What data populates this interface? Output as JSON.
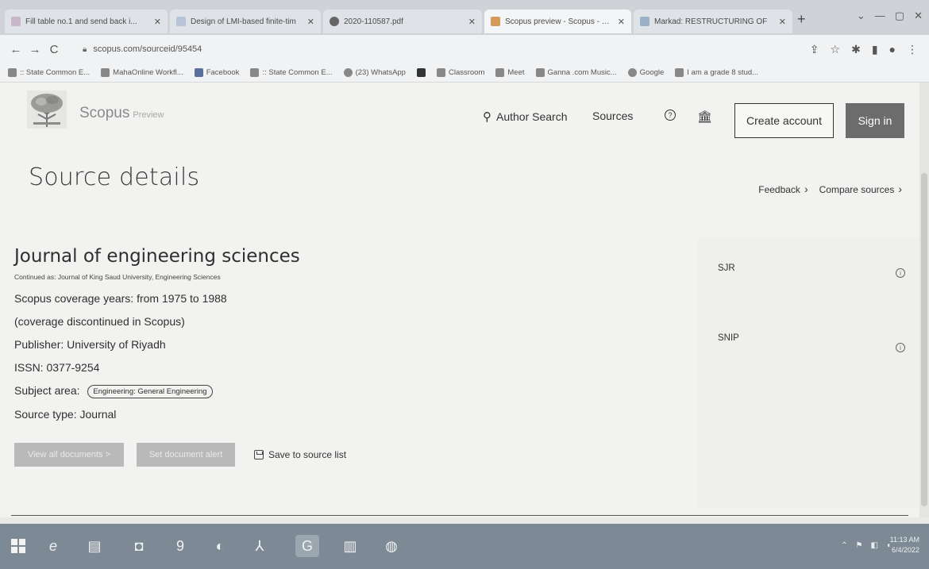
{
  "browser": {
    "tabs": [
      {
        "label": "Fill table no.1 and send back i...",
        "favicon_color": "#c9b6c9"
      },
      {
        "label": "Design of LMI-based finite-tim",
        "favicon_color": "#b7c4d6"
      },
      {
        "label": "2020-110587.pdf",
        "favicon_color": "#666666"
      },
      {
        "label": "Scopus preview - Scopus - Jou",
        "favicon_color": "#d49a5a"
      },
      {
        "label": "Markad: RESTRUCTURING OF",
        "favicon_color": "#9ab0c7"
      }
    ],
    "url": "scopus.com/sourceid/95454",
    "bookmarks": [
      ":: State Common E...",
      "MahaOnline Workfl...",
      "Facebook",
      ":: State Common E...",
      "(23) WhatsApp",
      "",
      "Classroom",
      "Meet",
      "Ganna .com Music...",
      "Google",
      "I am a grade 8 stud..."
    ]
  },
  "header": {
    "brand": "Scopus",
    "brand_suffix": "Preview",
    "nav": {
      "author_search": "Author Search",
      "sources": "Sources"
    },
    "create_account": "Create account",
    "sign_in": "Sign in"
  },
  "page": {
    "title": "Source details",
    "feedback": "Feedback",
    "compare": "Compare sources"
  },
  "journal": {
    "title": "Journal of engineering sciences",
    "continued_as": "Continued as: Journal of King Saud University, Engineering Sciences",
    "coverage": "Scopus coverage years:  from 1975 to 1988",
    "discontinued": "(coverage discontinued in Scopus)",
    "publisher_label": "Publisher:",
    "publisher": "University of Riyadh",
    "issn_label": "ISSN:",
    "issn": "0377-9254",
    "subject_label": "Subject area:",
    "subject": "Engineering: General Engineering",
    "type_label": "Source type:",
    "type": "Journal"
  },
  "actions": {
    "view_all": "View all documents >",
    "set_alert": "Set document alert",
    "save": "Save to source list"
  },
  "metrics": {
    "sjr": "SJR",
    "snip": "SNIP"
  },
  "taskbar": {
    "time": "11:13 AM",
    "date": "6/4/2022"
  },
  "colors": {
    "signin_bg": "#6c6c6c",
    "taskbar": "#7d8a95"
  }
}
